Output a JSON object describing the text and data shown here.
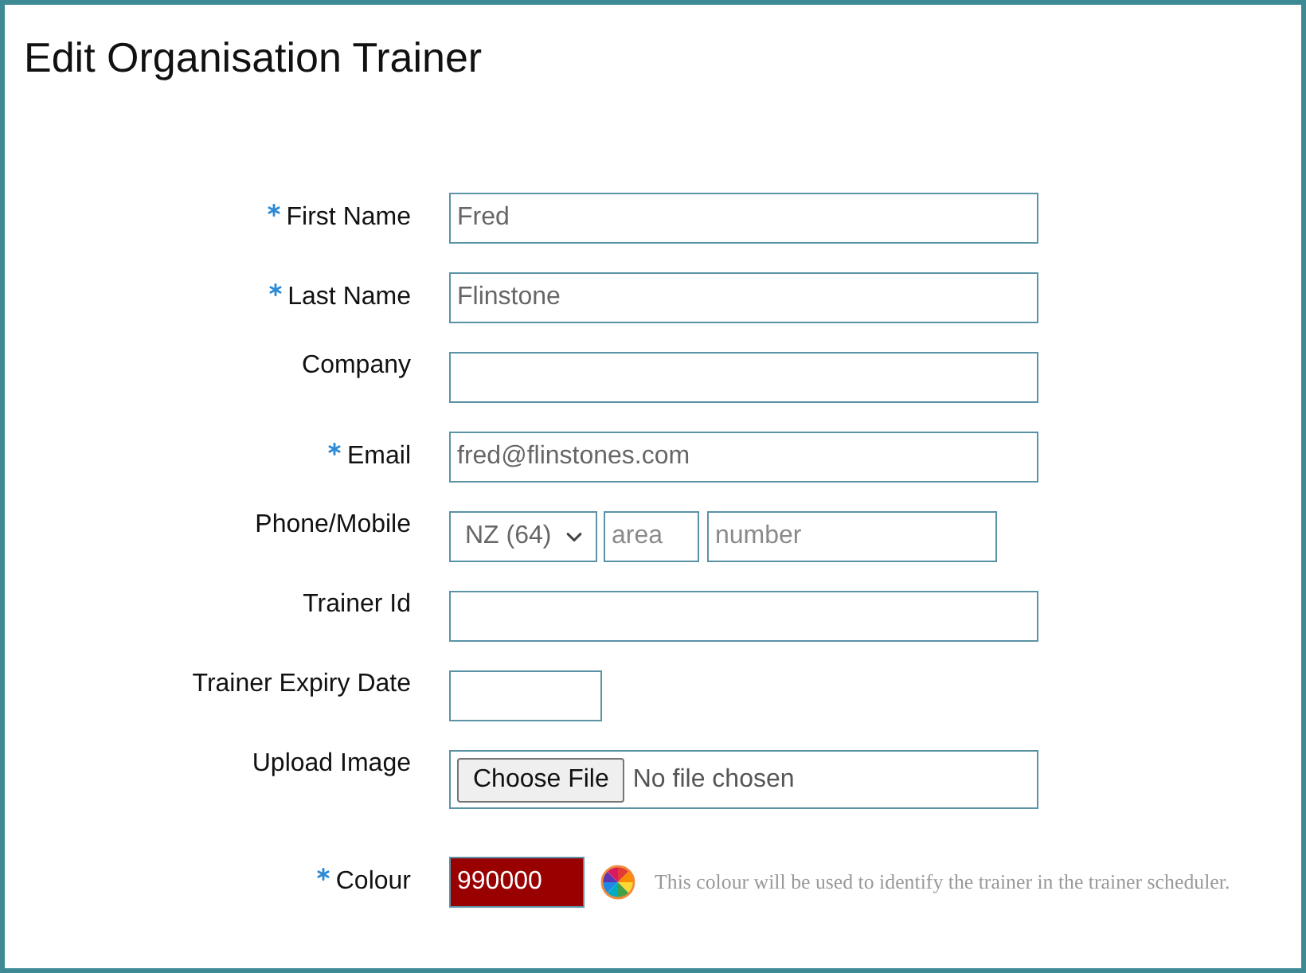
{
  "title": "Edit Organisation Trainer",
  "fields": [
    {
      "kind": "text",
      "label": "First Name",
      "required": true,
      "value": "Fred"
    },
    {
      "kind": "text",
      "label": "Last Name",
      "required": true,
      "value": "Flinstone"
    },
    {
      "kind": "text",
      "label": "Company",
      "required": false
    },
    {
      "kind": "text",
      "label": "Email",
      "required": true,
      "value": "fred@flinstones.com"
    },
    {
      "kind": "phone",
      "label": "Phone/Mobile",
      "required": false,
      "country": "NZ (64)",
      "area_placeholder": "area",
      "number_placeholder": "number"
    },
    {
      "kind": "text",
      "label": "Trainer Id",
      "required": false
    },
    {
      "kind": "date",
      "label": "Trainer Expiry Date",
      "required": false
    },
    {
      "kind": "file",
      "label": "Upload Image",
      "required": false,
      "button": "Choose File",
      "status": "No file chosen"
    },
    {
      "kind": "colour",
      "label": "Colour",
      "required": true,
      "value": "990000",
      "color": "#990000",
      "hint": "This colour will be used to identify the trainer in the trainer scheduler."
    }
  ]
}
